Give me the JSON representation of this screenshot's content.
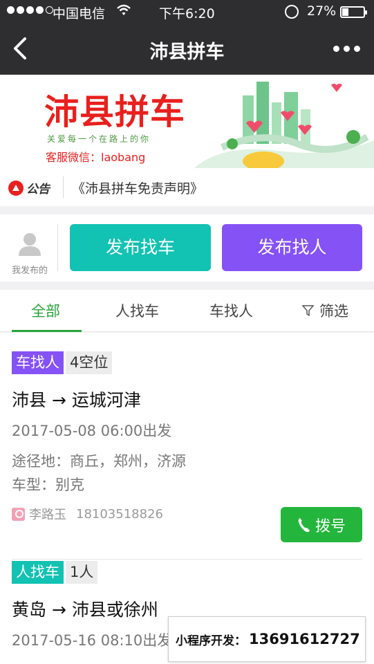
{
  "status_bar": {
    "carrier": "中国电信",
    "time": "下午6:20",
    "battery": "27%",
    "signal_icon": "signal-dots-icon",
    "wifi_icon": "wifi-icon",
    "lock_icon": "rotation-lock-icon"
  },
  "nav": {
    "title": "沛县拼车",
    "back_icon": "back-chevron-icon",
    "more_icon": "more-dots-icon"
  },
  "banner": {
    "title": "沛县拼车",
    "subtitle": "关爱每一个在路上的你",
    "wechat": "客服微信：laobang"
  },
  "notice": {
    "icon_label": "公告",
    "text": "《沛县拼车免责声明》"
  },
  "actions": {
    "mine_label": "我发布的",
    "find_car": "发布找车",
    "find_people": "发布找人"
  },
  "tabs": {
    "items": [
      "全部",
      "人找车",
      "车找人",
      "筛选"
    ],
    "active": "全部"
  },
  "listings": [
    {
      "type": "车找人",
      "seats": "4空位",
      "route": "沛县 → 运城河津",
      "departure": "2017-05-08 06:00出发",
      "via": "途径地：商丘，郑州，济源",
      "car_model": "车型：别克",
      "name": "李路玉",
      "phone": "18103518826",
      "dial_label": "拨号"
    },
    {
      "type": "人找车",
      "seats": "1人",
      "route": "黄岛 → 沛县或徐州",
      "departure": "2017-05-16 08:10出发"
    }
  ],
  "watermark": {
    "label": "小程序开发：",
    "number": "13691612727"
  },
  "colors": {
    "header_bg": "#2e2e30",
    "teal": "#12c2b2",
    "purple": "#8552f6",
    "green": "#26a33a",
    "dial_green": "#23b53c",
    "red": "#e8201e"
  }
}
